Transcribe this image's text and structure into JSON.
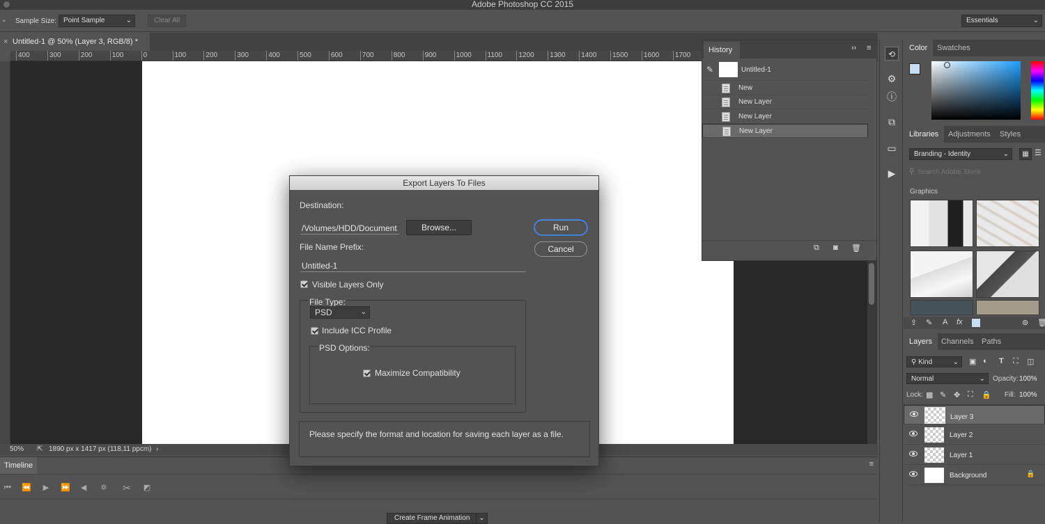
{
  "app": {
    "title": "Adobe Photoshop CC 2015"
  },
  "options_bar": {
    "sample_size_label": "Sample Size:",
    "sample_size_value": "Point Sample",
    "clear_all": "Clear All",
    "workspace": "Essentials"
  },
  "document": {
    "tab_title": "Untitled-1 @ 50% (Layer 3, RGB/8) *",
    "zoom": "50%",
    "doc_info": "1890 px x 1417 px (118,11 ppcm)"
  },
  "ruler": {
    "h_ticks": [
      "400",
      "300",
      "200",
      "100",
      "0",
      "100",
      "200",
      "300",
      "400",
      "500",
      "600",
      "700",
      "800",
      "900",
      "1000",
      "1100",
      "1200",
      "1300",
      "1400",
      "1500",
      "1600",
      "1700"
    ]
  },
  "timeline": {
    "tab": "Timeline",
    "create_button": "Create Frame Animation"
  },
  "history": {
    "tab": "History",
    "snapshot": "Untitled-1",
    "items": [
      "New",
      "New Layer",
      "New Layer",
      "New Layer"
    ]
  },
  "color_panel": {
    "tabs": [
      "Color",
      "Swatches"
    ],
    "fg_color": "#c9ddf2",
    "bg_color": "#ffffff"
  },
  "libraries_panel": {
    "tabs": [
      "Libraries",
      "Adjustments",
      "Styles"
    ],
    "library": "Branding - Identity",
    "search_placeholder": "Search Adobe Stock",
    "section": "Graphics"
  },
  "layers_panel": {
    "tabs": [
      "Layers",
      "Channels",
      "Paths"
    ],
    "kind": "Kind",
    "blend_mode": "Normal",
    "opacity_label": "Opacity:",
    "opacity": "100%",
    "lock_label": "Lock:",
    "fill_label": "Fill:",
    "fill": "100%",
    "layers": [
      "Layer 3",
      "Layer 2",
      "Layer 1",
      "Background"
    ]
  },
  "dialog": {
    "title": "Export Layers To Files",
    "destination_label": "Destination:",
    "destination_value": "/Volumes/HDD/Document",
    "browse": "Browse...",
    "run": "Run",
    "cancel": "Cancel",
    "prefix_label": "File Name Prefix:",
    "prefix_value": "Untitled-1",
    "visible_only": "Visible Layers Only",
    "file_type_label": "File Type:",
    "file_type_value": "PSD",
    "include_icc": "Include ICC Profile",
    "psd_options_label": "PSD Options:",
    "maximize_compat": "Maximize Compatibility",
    "hint": "Please specify the format and location for saving each layer as a file."
  }
}
